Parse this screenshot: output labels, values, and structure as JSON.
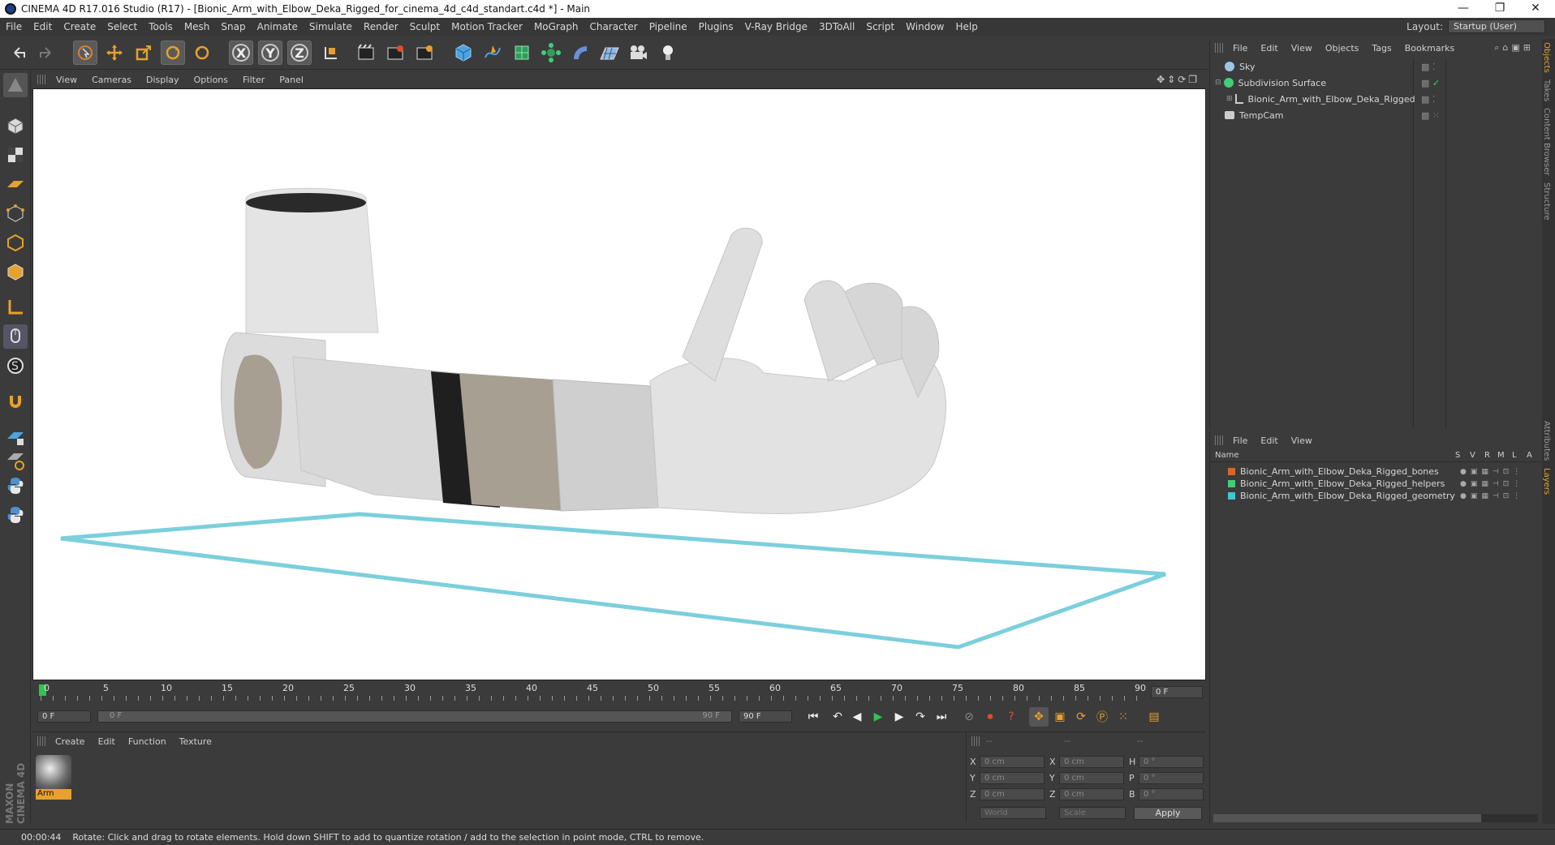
{
  "window": {
    "title": "CINEMA 4D R17.016 Studio (R17) - [Bionic_Arm_with_Elbow_Deka_Rigged_for_cinema_4d_c4d_standart.c4d *] - Main",
    "controls": [
      "—",
      "❐",
      "✕"
    ]
  },
  "menubar": {
    "items": [
      "File",
      "Edit",
      "Create",
      "Select",
      "Tools",
      "Mesh",
      "Snap",
      "Animate",
      "Simulate",
      "Render",
      "Sculpt",
      "Motion Tracker",
      "MoGraph",
      "Character",
      "Pipeline",
      "Plugins",
      "V-Ray Bridge",
      "3DToAll",
      "Script",
      "Window",
      "Help"
    ],
    "layout_label": "Layout:",
    "layout_value": "Startup (User)"
  },
  "toolbar": {
    "icons": [
      "undo-icon",
      "redo-icon",
      "select-arrow-icon",
      "move-icon",
      "scale-icon",
      "rotate-icon",
      "rotate-alt-icon",
      "x-axis-icon",
      "y-axis-icon",
      "z-axis-icon",
      "coordinate-system-icon",
      "render-view-icon",
      "render-picture-viewer-icon",
      "render-settings-icon",
      "cube-primitive-icon",
      "spline-pen-icon",
      "subdivision-icon",
      "array-icon",
      "deformer-icon",
      "floor-icon",
      "camera-icon",
      "light-icon"
    ],
    "axis_labels": [
      "X",
      "Y",
      "Z"
    ]
  },
  "viewport": {
    "menu": [
      "View",
      "Cameras",
      "Display",
      "Options",
      "Filter",
      "Panel"
    ],
    "colors": {
      "background": "#ffffff",
      "floor_outline": "#7ccfdc",
      "arm_light": "#e6e6e6",
      "arm_accent": "#a69f92"
    }
  },
  "timeline": {
    "ticks": [
      "0",
      "5",
      "10",
      "15",
      "20",
      "25",
      "30",
      "35",
      "40",
      "45",
      "50",
      "55",
      "60",
      "65",
      "70",
      "75",
      "80",
      "85",
      "90"
    ],
    "current_frame": "0 F",
    "start_field": "0 F",
    "range_start": "0 F",
    "range_end": "90 F",
    "end_field": "90 F",
    "playhead_fraction": 0.0
  },
  "materials": {
    "menu": [
      "Create",
      "Edit",
      "Function",
      "Texture"
    ],
    "items": [
      {
        "name": "Arm"
      }
    ],
    "brand": "MAXON CINEMA 4D"
  },
  "coordinates": {
    "headers": [
      "--",
      "--",
      "--"
    ],
    "rows": [
      {
        "axis": "X",
        "pos": "0 cm",
        "axis2": "X",
        "size": "0 cm",
        "axis3": "H",
        "rot": "0 °"
      },
      {
        "axis": "Y",
        "pos": "0 cm",
        "axis2": "Y",
        "size": "0 cm",
        "axis3": "P",
        "rot": "0 °"
      },
      {
        "axis": "Z",
        "pos": "0 cm",
        "axis2": "Z",
        "size": "0 cm",
        "axis3": "B",
        "rot": "0 °"
      }
    ],
    "mode_world": "World",
    "mode_scale": "Scale",
    "apply_label": "Apply"
  },
  "object_manager": {
    "menu": [
      "File",
      "Edit",
      "View",
      "Objects",
      "Tags",
      "Bookmarks"
    ],
    "objects": [
      {
        "name": "Sky",
        "icon": "sky-icon"
      },
      {
        "name": "Subdivision Surface",
        "icon": "subdivision-icon"
      },
      {
        "name": "Bionic_Arm_with_Elbow_Deka_Rigged",
        "icon": "null-icon"
      },
      {
        "name": "TempCam",
        "icon": "camera-icon"
      }
    ]
  },
  "layer_manager": {
    "menu": [
      "File",
      "Edit",
      "View"
    ],
    "columns": [
      "Name",
      "S",
      "V",
      "R",
      "M",
      "L",
      "A"
    ],
    "layers": [
      {
        "name": "Bionic_Arm_with_Elbow_Deka_Rigged_bones",
        "color": "#d46a2a"
      },
      {
        "name": "Bionic_Arm_with_Elbow_Deka_Rigged_helpers",
        "color": "#3fcf7a"
      },
      {
        "name": "Bionic_Arm_with_Elbow_Deka_Rigged_geometry",
        "color": "#3fc7cf"
      }
    ]
  },
  "right_tabs": [
    "Objects",
    "Takes",
    "Content Browser",
    "Structure",
    "Attributes",
    "Layers"
  ],
  "status": {
    "time": "00:00:44",
    "message": "Rotate: Click and drag to rotate elements. Hold down SHIFT to add to quantize rotation / add to the selection in point mode, CTRL to remove."
  }
}
